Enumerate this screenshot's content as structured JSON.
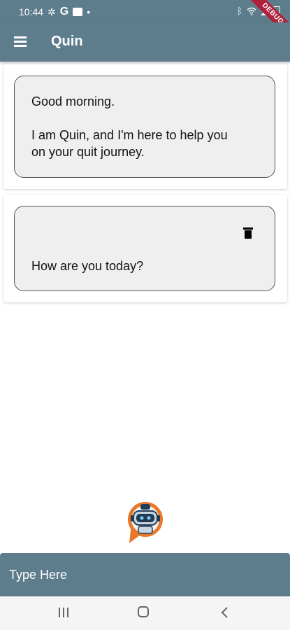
{
  "status_bar": {
    "time": "10:44",
    "debug_label": "DEBUG"
  },
  "app_bar": {
    "title": "Quin",
    "menu_icon": "hamburger-menu-icon"
  },
  "messages": [
    {
      "lines": [
        "Good morning.",
        "",
        "I am Quin, and I'm here to help you",
        "on your quit journey."
      ]
    },
    {
      "lines": [
        "How are you today?"
      ],
      "has_delete": true,
      "delete_icon": "trash-icon"
    }
  ],
  "input": {
    "placeholder": "Type Here"
  },
  "colors": {
    "primary": "#5d7d8c",
    "bubble_bg": "#efefef",
    "bubble_border": "#555555",
    "avatar_orange": "#e8782a",
    "avatar_navy": "#1f3b57"
  },
  "nav": {
    "recents_icon": "recents-icon",
    "home_icon": "home-icon",
    "back_icon": "back-icon"
  }
}
